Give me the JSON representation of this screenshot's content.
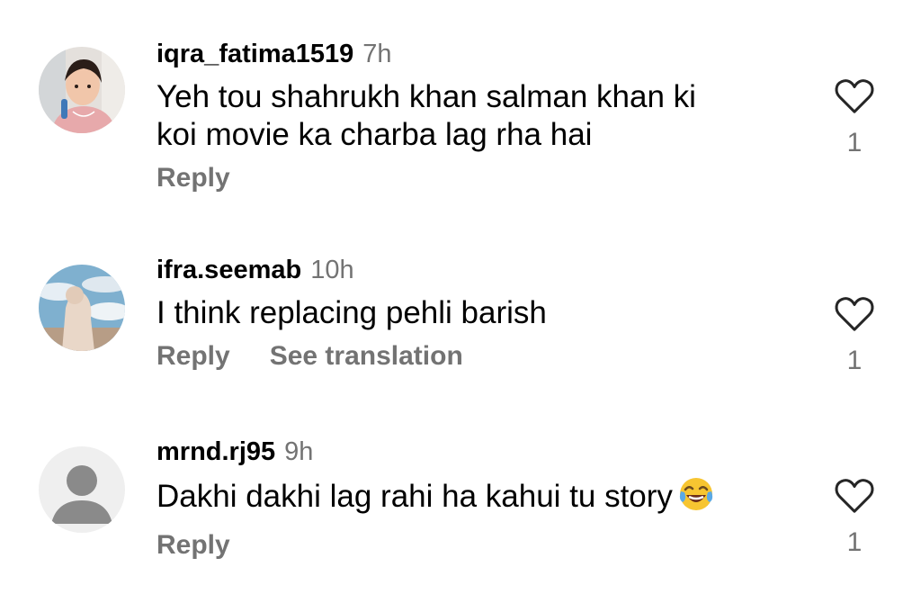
{
  "comments": [
    {
      "username": "iqra_fatima1519",
      "time": "7h",
      "text_lines": [
        "Yeh tou shahrukh khan salman khan ki",
        "koi movie ka charba lag rha hai"
      ],
      "actions": [
        "Reply"
      ],
      "likes": "1",
      "avatar_icon": "child-photo-avatar",
      "like_icon": "heart-outline-icon"
    },
    {
      "username": "ifra.seemab",
      "time": "10h",
      "text_lines": [
        "I think replacing pehli barish"
      ],
      "actions": [
        "Reply",
        "See translation"
      ],
      "likes": "1",
      "avatar_icon": "sky-photo-avatar",
      "like_icon": "heart-outline-icon"
    },
    {
      "username": "mrnd.rj95",
      "time": "9h",
      "text_lines": [
        "Dakhi dakhi lag rahi ha kahui tu story"
      ],
      "emoji": "face-with-tears-of-joy",
      "actions": [
        "Reply"
      ],
      "likes": "1",
      "avatar_icon": "default-user-avatar",
      "like_icon": "heart-outline-icon"
    }
  ],
  "colors": {
    "primary_text": "#000000",
    "secondary_text": "#737373",
    "background": "#ffffff",
    "icon": "#262626"
  }
}
